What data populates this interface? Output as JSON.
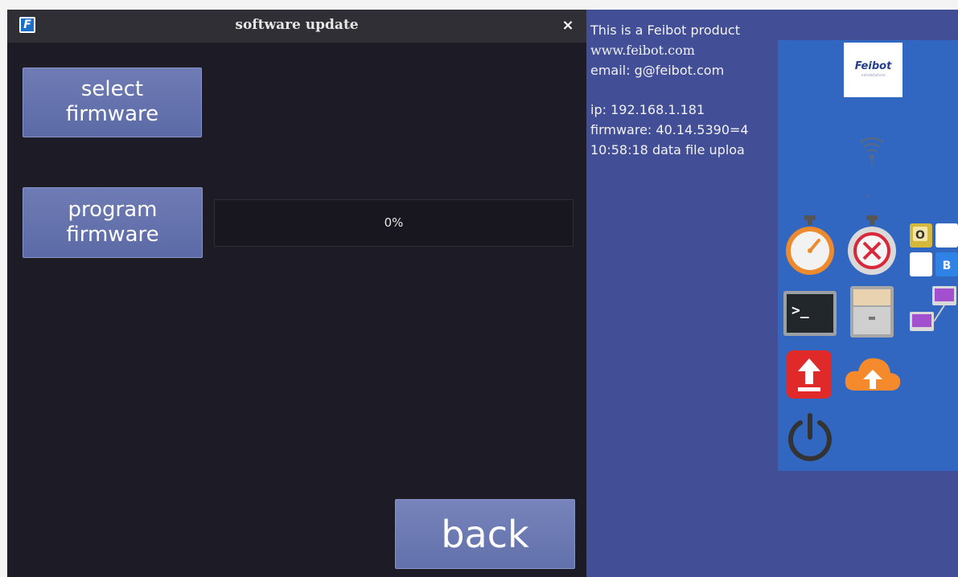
{
  "dialog": {
    "title": "software update",
    "app_logo_letter": "F",
    "close_glyph": "×",
    "select_button": [
      "select",
      "firmware"
    ],
    "program_button": [
      "program",
      "firmware"
    ],
    "progress": {
      "label": "0%",
      "fraction": 0.0
    },
    "back_label": "back"
  },
  "desktop": {
    "info_lines": [
      "This is a Feibot product",
      "www.feibot.com",
      "email: g@feibot.com",
      "",
      "ip: 192.168.1.181",
      "firmware: 40.14.5390=4",
      "10:58:18 data file uploa"
    ],
    "brand": {
      "name": "Feibot",
      "sub": "vandelaturo"
    },
    "launcher_icons": [
      "wifi-icon",
      "chevron-down-icon",
      "stopwatch-icon",
      "stopwatch-cancel-icon",
      "ob-grid-icon",
      "terminal-icon",
      "file-cabinet-icon",
      "network-icon",
      "upload-arrow-icon",
      "cloud-upload-icon",
      "power-icon"
    ],
    "ob_letters": {
      "o": "O",
      "b": "B"
    },
    "terminal_prompt": ">_"
  },
  "colors": {
    "dialog_bg": "#1d1c26",
    "titlebar": "#302f35",
    "button": "#6473ac",
    "desktop_bg": "#424f96",
    "panel_bg": "#3267c1"
  }
}
